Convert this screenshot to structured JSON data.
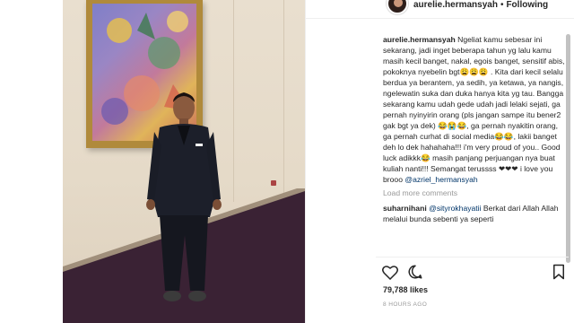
{
  "header": {
    "username": "aurelie.hermansyah",
    "separator": "•",
    "follow_status": "Following"
  },
  "caption": {
    "username": "aurelie.hermansyah",
    "text_part1": "Ngeliat kamu sebesar ini sekarang, jadi inget beberapa tahun yg lalu kamu masih kecil banget, nakal, egois banget, sensitif abis, pokoknya nyebelin bgt😩😩😩 . Kita dari kecil selalu berdua ya berantem, ya sedih, ya ketawa, ya nangis, ngelewatin suka dan duka hanya kita yg tau. Bangga sekarang kamu udah gede udah jadi lelaki sejati, ga pernah nyinyirin orang (pls jangan sampe itu bener2 gak bgt ya dek) 😂😭😂, ga pernah nyakitin orang, ga pernah curhat di social media😂😂, lakii banget deh lo dek hahahaha!!! i'm very proud of you.. Good luck adikkk😂 masih panjang perjuangan nya buat kuliah nanti!!! Semangat terussss ❤❤❤ i love you brooo",
    "mention": "@azriel_hermansyah"
  },
  "load_more": "Load more comments",
  "comment": {
    "username": "suharnihani",
    "mention": "@sityrokhayatii",
    "text": "Berkat dari Allah Allah melalui bunda sebenti ya seperti"
  },
  "actions": {
    "like_icon": "heart-icon",
    "comment_icon": "comment-icon",
    "save_icon": "bookmark-icon"
  },
  "likes": "79,788 likes",
  "timestamp": "8 HOURS AGO"
}
